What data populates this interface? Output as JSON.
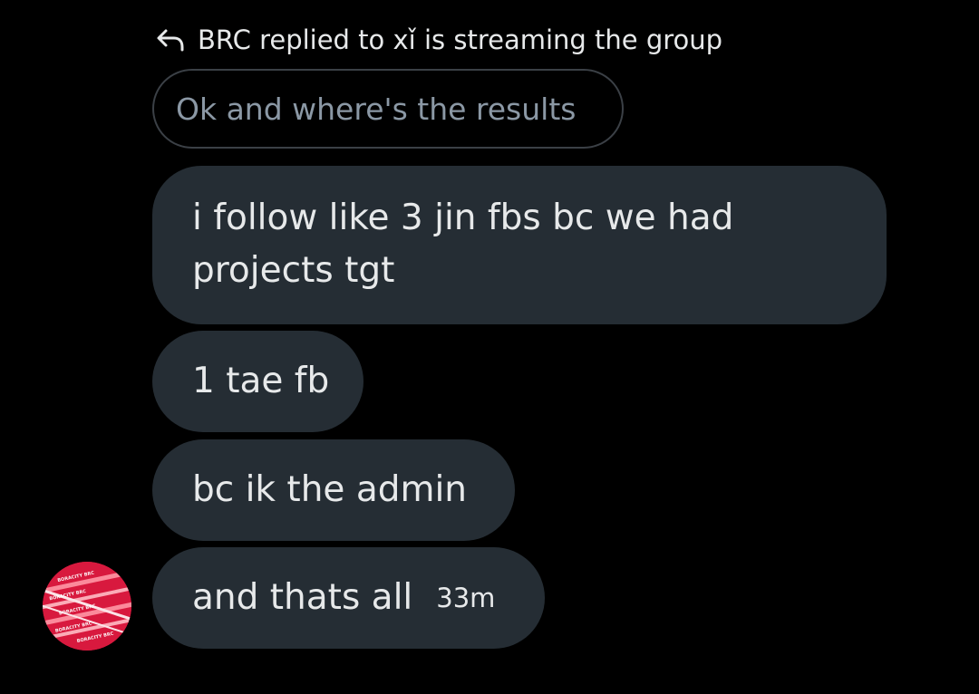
{
  "reply_header": {
    "text": "BRC replied to xǐ is streaming the group",
    "icon": "reply-arrow-icon"
  },
  "quoted_message": {
    "text": "Ok and where's the results"
  },
  "messages": [
    {
      "text": "i follow like 3 jin fbs bc we had projects tgt"
    },
    {
      "text": "1 tae fb"
    },
    {
      "text": "bc ik the admin"
    },
    {
      "text": "and thats all",
      "timestamp": "33m"
    }
  ],
  "avatar": {
    "icon": "boracity-avatar-icon",
    "watermark": "BORACITY BRC"
  },
  "colors": {
    "background": "#000000",
    "bubble": "#252d34",
    "text": "#e7e9ea",
    "muted_text": "#8b98a5",
    "quoted_border": "#3b4046",
    "avatar_red": "#d8193e"
  }
}
